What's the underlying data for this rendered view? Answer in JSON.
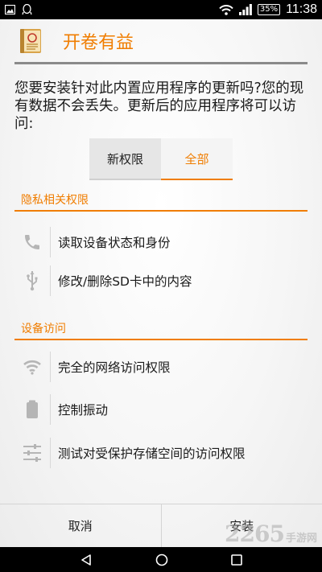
{
  "status_bar": {
    "left_icons": [
      "image-icon",
      "qq-icon"
    ],
    "right_icons": [
      "wifi-icon",
      "signal-icon"
    ],
    "battery": "35%",
    "time": "11:38"
  },
  "header": {
    "app_icon": "book-app-icon",
    "app_name": "开卷有益"
  },
  "intro_text": "您要安装针对此内置应用程序的更新吗?您的现有数据不会丢失。更新后的应用程序将可以访问:",
  "tabs": [
    {
      "label": "新权限",
      "active": false
    },
    {
      "label": "全部",
      "active": true
    }
  ],
  "sections": [
    {
      "title": "隐私相关权限",
      "items": [
        {
          "icon": "phone-icon",
          "label": "读取设备状态和身份"
        },
        {
          "icon": "usb-icon",
          "label": "修改/删除SD卡中的内容"
        }
      ]
    },
    {
      "title": "设备访问",
      "items": [
        {
          "icon": "wifi-icon",
          "label": "完全的网络访问权限"
        },
        {
          "icon": "vibrate-icon",
          "label": "控制振动"
        },
        {
          "icon": "sliders-icon",
          "label": "测试对受保护存储空间的访问权限"
        }
      ]
    }
  ],
  "buttons": {
    "cancel": "取消",
    "install": "安装"
  },
  "watermark": {
    "number": "2265",
    "text": "手游网"
  },
  "colors": {
    "accent": "#f07d00",
    "text": "#1a1a1a",
    "icon": "#b5b5b5"
  }
}
